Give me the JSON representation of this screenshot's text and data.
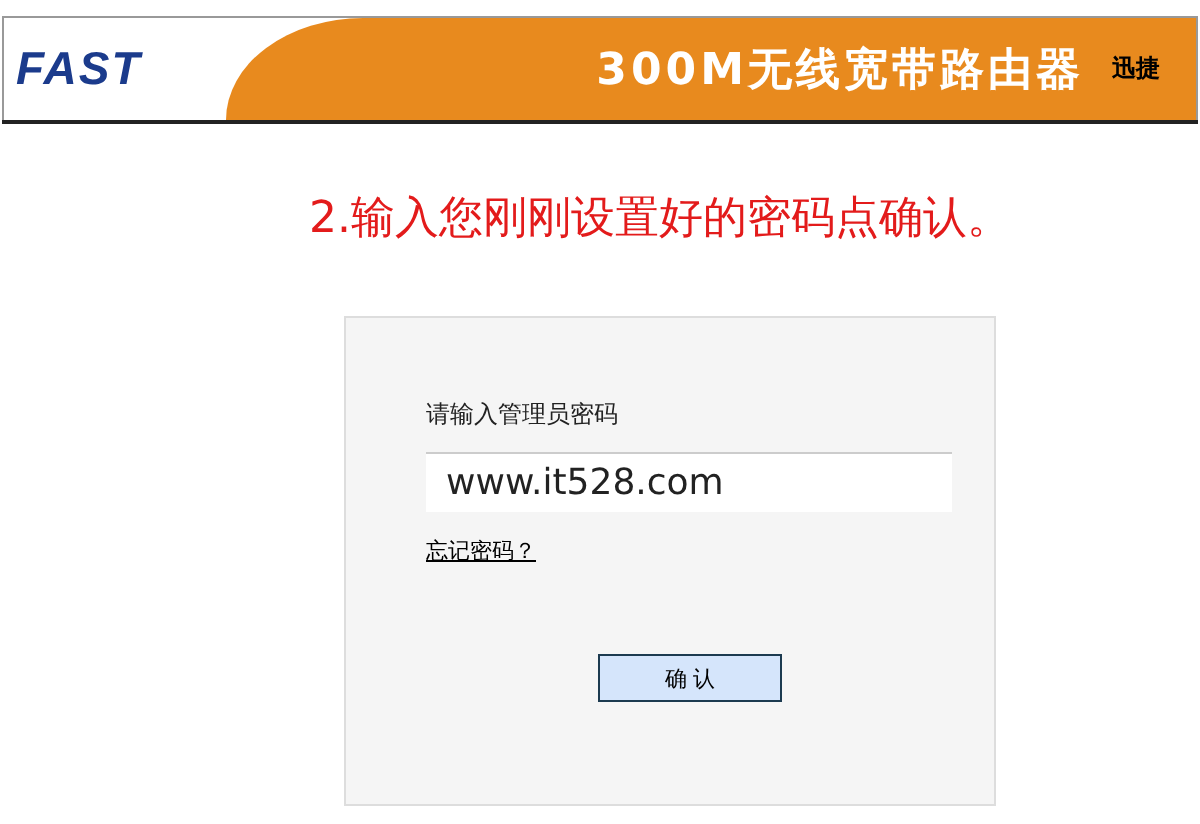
{
  "header": {
    "logo": "FAST",
    "title": "300M无线宽带路由器",
    "brand": "迅捷"
  },
  "instruction": "2.输入您刚刚设置好的密码点确认。",
  "login": {
    "label": "请输入管理员密码",
    "password": {
      "value": "www.it528.com"
    },
    "forgot_link": "忘记密码？",
    "confirm_button": "确 认"
  }
}
